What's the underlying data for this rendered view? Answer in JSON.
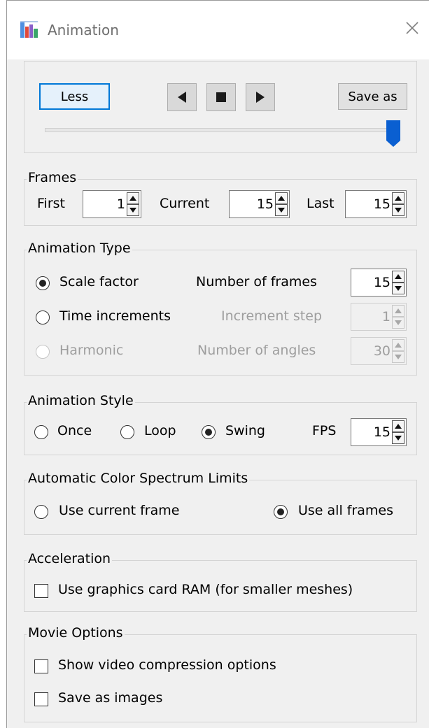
{
  "window": {
    "title": "Animation"
  },
  "playback": {
    "less_label": "Less",
    "save_as_label": "Save as",
    "slider_value_fraction": 1.0
  },
  "frames": {
    "title": "Frames",
    "first_label": "First",
    "first_value": "1",
    "current_label": "Current",
    "current_value": "15",
    "last_label": "Last",
    "last_value": "15"
  },
  "animation_type": {
    "title": "Animation Type",
    "scale_factor_label": "Scale factor",
    "time_increments_label": "Time increments",
    "harmonic_label": "Harmonic",
    "num_frames_label": "Number of frames",
    "num_frames_value": "15",
    "increment_step_label": "Increment step",
    "increment_step_value": "1",
    "num_angles_label": "Number of angles",
    "num_angles_value": "30",
    "selected": "Scale factor"
  },
  "animation_style": {
    "title": "Animation Style",
    "once_label": "Once",
    "loop_label": "Loop",
    "swing_label": "Swing",
    "fps_label": "FPS",
    "fps_value": "15",
    "selected": "Swing"
  },
  "color_spectrum": {
    "title": "Automatic Color Spectrum Limits",
    "current_frame_label": "Use current frame",
    "all_frames_label": "Use all frames",
    "selected": "Use all frames"
  },
  "acceleration": {
    "title": "Acceleration",
    "gpu_ram_label": "Use graphics card RAM (for smaller meshes)",
    "gpu_ram_checked": false
  },
  "movie_options": {
    "title": "Movie Options",
    "compression_label": "Show video compression options",
    "compression_checked": false,
    "save_images_label": "Save as images",
    "save_images_checked": false
  },
  "colors": {
    "accent": "#0078d7",
    "thumb": "#0a5fd1",
    "group_border": "#d4d4d4",
    "disabled_text": "#9e9e9e"
  }
}
